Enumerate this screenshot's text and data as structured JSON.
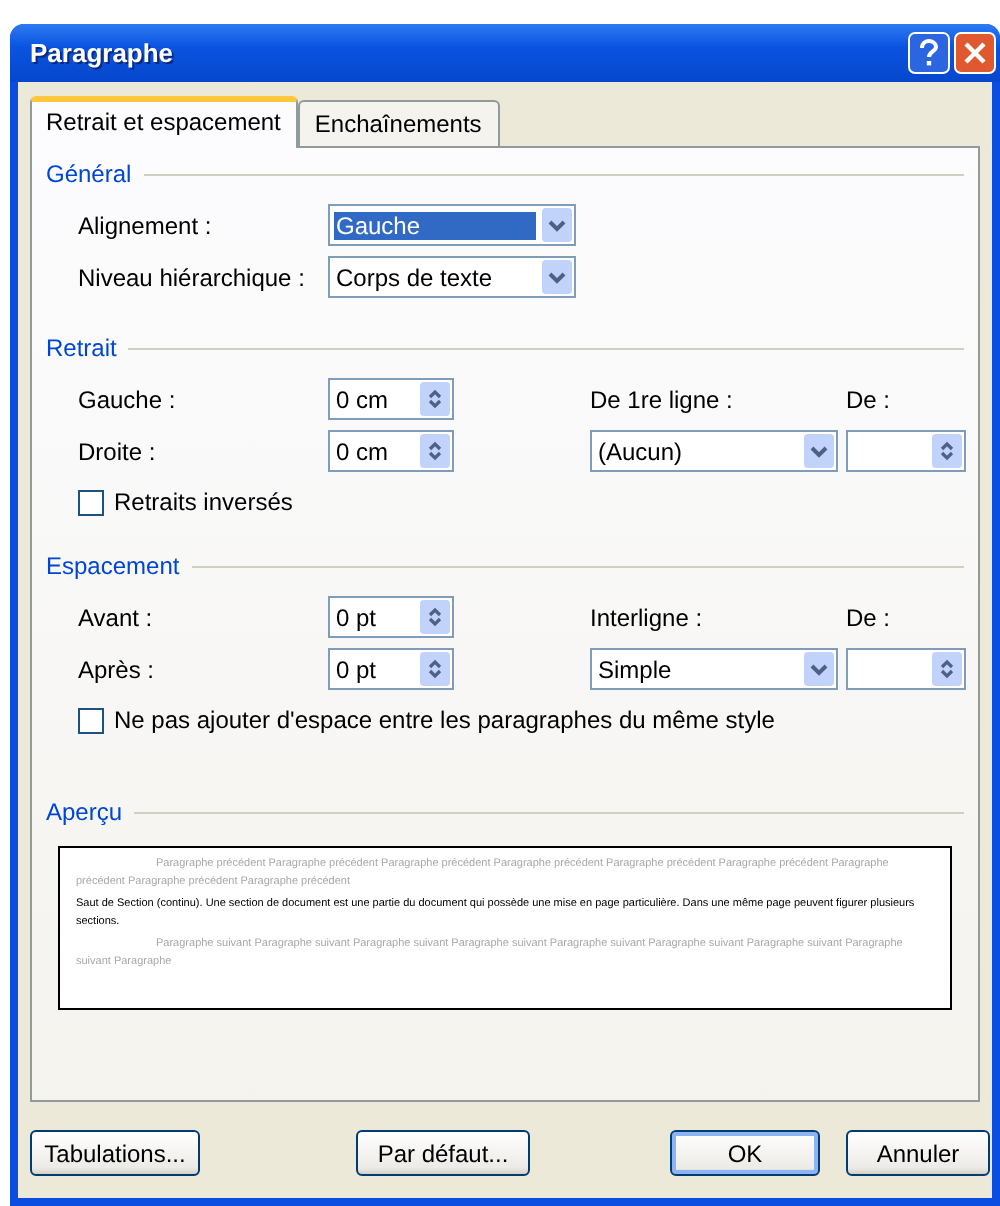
{
  "window": {
    "title": "Paragraphe"
  },
  "tabs": [
    {
      "label": "Retrait et espacement",
      "selected": true
    },
    {
      "label": "Enchaînements",
      "selected": false
    }
  ],
  "general": {
    "title": "Général",
    "fields": [
      {
        "label": "Alignement :",
        "value": "Gauche",
        "highlighted": true
      },
      {
        "label": "Niveau hiérarchique :",
        "value": "Corps de texte",
        "highlighted": false
      }
    ]
  },
  "indent": {
    "title": "Retrait",
    "fields": [
      {
        "label": "Gauche :",
        "value": "0 cm"
      },
      {
        "label": "Droite :",
        "value": "0 cm"
      }
    ],
    "special": {
      "label": "De 1re ligne :",
      "value": "(Aucun)"
    },
    "by": {
      "label": "De :"
    },
    "checkbox": {
      "label": "Retraits inversés",
      "checked": false
    }
  },
  "spacing": {
    "title": "Espacement",
    "fields": [
      {
        "label": "Avant :",
        "value": "0 pt"
      },
      {
        "label": "Après :",
        "value": "0 pt"
      }
    ],
    "special": {
      "label": "Interligne :",
      "value": "Simple"
    },
    "by": {
      "label": "De :"
    },
    "checkbox": {
      "label": "Ne pas ajouter d'espace entre les paragraphes du même style",
      "checked": false
    }
  },
  "preview": {
    "title": "Aperçu",
    "previous_text": "Paragraphe précédent Paragraphe précédent Paragraphe précédent Paragraphe précédent Paragraphe précédent Paragraphe précédent Paragraphe précédent Paragraphe précédent Paragraphe précédent",
    "sample_text": "Saut de Section (continu). Une section de document est une partie du document qui possède une mise en page particulière. Dans une même page peuvent figurer plusieurs sections.",
    "next_text": "Paragraphe suivant Paragraphe suivant Paragraphe suivant Paragraphe suivant Paragraphe suivant Paragraphe suivant Paragraphe suivant Paragraphe suivant Paragraphe"
  },
  "buttons": [
    {
      "label": "Tabulations...",
      "default": false
    },
    {
      "label": "Par défaut...",
      "default": false
    },
    {
      "label": "OK",
      "default": true
    },
    {
      "label": "Annuler",
      "default": false
    }
  ]
}
